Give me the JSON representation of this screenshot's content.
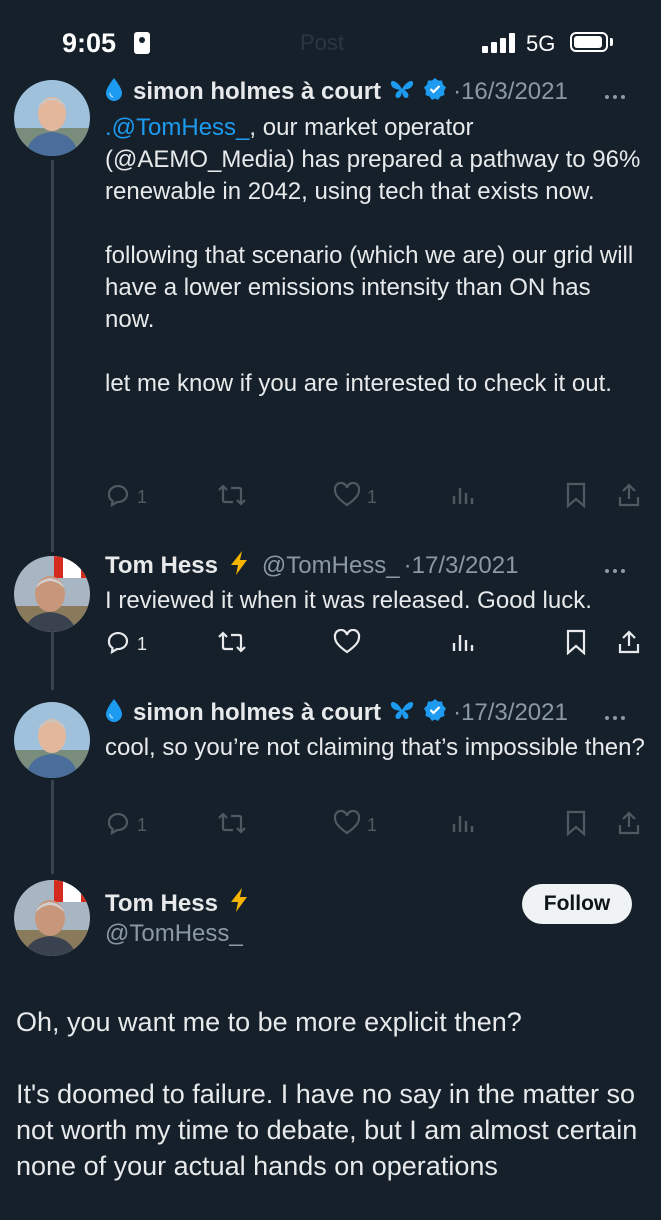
{
  "status_bar": {
    "time": "9:05",
    "network": "5G",
    "faded_title": "Post"
  },
  "tweets": [
    {
      "name": "simon holmes à court",
      "dot": "·",
      "date": "16/3/2021",
      "body": [
        {
          "mention": ".@TomHess_",
          "text": ", our market operator (@AEMO_Media) has prepared a pathway to 96% renewable in 2042, using tech that exists now."
        },
        {
          "text": "following that scenario (which we are) our grid will have a lower emissions intensity than ON has now."
        },
        {
          "text": "let me know if you are interested to check it out."
        }
      ],
      "actions": {
        "reply_count": "1",
        "like_count": "1"
      }
    },
    {
      "name": "Tom Hess",
      "handle": "@TomHess_",
      "dot": "·",
      "date": "17/3/2021",
      "body": "I reviewed it when it was released. Good luck.",
      "actions": {
        "reply_count": "1"
      }
    },
    {
      "name": "simon holmes à court",
      "dot": "·",
      "date": "17/3/2021",
      "body": "cool, so you’re not claiming that’s impossible then?",
      "actions": {
        "reply_count": "1",
        "like_count": "1"
      }
    }
  ],
  "main_tweet": {
    "name": "Tom Hess",
    "handle": "@TomHess_",
    "follow_label": "Follow",
    "body": [
      "Oh, you want me to be more explicit then?",
      "It's doomed to failure. I have no say in the matter so not worth my time to debate, but I am almost certain none of your actual hands on operations"
    ]
  },
  "colors": {
    "background": "#15202b",
    "accent": "#1d9bf0",
    "muted": "#8b98a5",
    "thread_line": "#38444d",
    "verified": "#1d9bf0",
    "lightning": "#f5b400"
  },
  "icons": [
    "water-drop-icon",
    "butterfly-icon",
    "verified-badge-icon",
    "lightning-icon",
    "reply-icon",
    "retweet-icon",
    "like-icon",
    "views-icon",
    "bookmark-icon",
    "share-icon",
    "more-icon"
  ]
}
